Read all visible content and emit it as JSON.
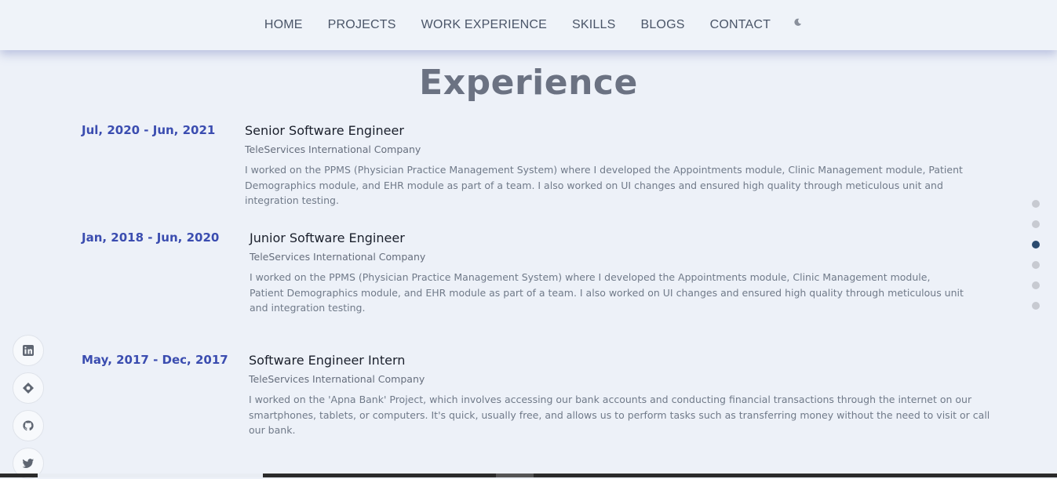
{
  "nav": {
    "items": [
      "HOME",
      "PROJECTS",
      "WORK EXPERIENCE",
      "SKILLS",
      "BLOGS",
      "CONTACT"
    ],
    "theme_toggle_icon": "moon-icon"
  },
  "page_title": "Experience",
  "experiences": [
    {
      "date": "Jul, 2020 - Jun, 2021",
      "role": "Senior Software Engineer",
      "company": "TeleServices International Company",
      "description": "I worked on the PPMS (Physician Practice Management System) where I developed the Appointments module, Clinic Management module, Patient Demographics module, and EHR module as part of a team. I also worked on UI changes and ensured high quality through meticulous unit and integration testing."
    },
    {
      "date": "Jan, 2018 - Jun, 2020",
      "role": "Junior Software Engineer",
      "company": "TeleServices International Company",
      "description": "I worked on the PPMS (Physician Practice Management System) where I developed the Appointments module, Clinic Management module, Patient Demographics module, and EHR module as part of a team. I also worked on UI changes and ensured high quality through meticulous unit and integration testing."
    },
    {
      "date": "May, 2017 - Dec, 2017",
      "role": "Software Engineer Intern",
      "company": "TeleServices International Company",
      "description": "I worked on the 'Apna Bank' Project, which involves accessing our bank accounts and conducting financial transactions through the internet on our smartphones, tablets, or computers. It's quick, usually free, and allows us to perform tasks such as transferring money without the need to visit or call our bank."
    }
  ],
  "section_dots": {
    "count": 6,
    "active_index": 2,
    "active_color": "#2a4a6e",
    "inactive_color": "#c7cad1"
  },
  "social_links": [
    "linkedin-icon",
    "location-icon",
    "github-icon",
    "twitter-icon"
  ],
  "colors": {
    "accent": "#3b4db0",
    "background": "#edf1f8",
    "title": "#6b7282"
  }
}
